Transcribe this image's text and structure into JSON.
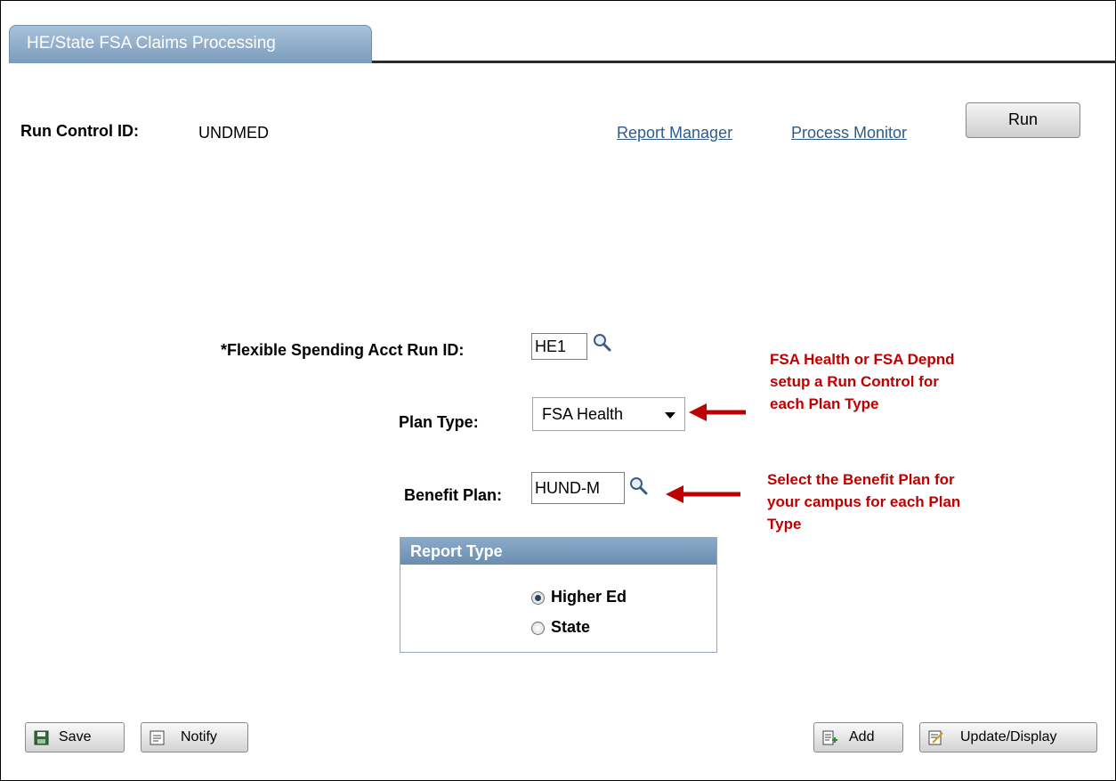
{
  "tab": {
    "title": "HE/State FSA Claims Processing"
  },
  "header": {
    "run_control_label": "Run Control ID:",
    "run_control_value": "UNDMED",
    "report_manager_link": "Report Manager",
    "process_monitor_link": "Process Monitor",
    "run_button": "Run"
  },
  "form": {
    "fsa_run_id": {
      "label": "*Flexible Spending Acct Run ID:",
      "value": "HE1"
    },
    "plan_type": {
      "label": "Plan Type:",
      "value": "FSA Health"
    },
    "benefit_plan": {
      "label": "Benefit Plan:",
      "value": "HUND-M"
    }
  },
  "annotations": {
    "plan_type_note": [
      "FSA Health or FSA Depnd",
      "setup a Run Control for",
      "each Plan Type"
    ],
    "benefit_plan_note": [
      "Select the Benefit Plan for",
      "your campus for each Plan",
      "Type"
    ]
  },
  "report_type": {
    "header": "Report Type",
    "options": [
      {
        "label": "Higher Ed",
        "selected": true
      },
      {
        "label": "State",
        "selected": false
      }
    ]
  },
  "footer": {
    "save_button": "Save",
    "notify_button": "Notify",
    "add_button": "Add",
    "update_display_button": "Update/Display"
  },
  "colors": {
    "tab": "#7b9cbc",
    "link": "#2e5c8a",
    "annotation": "#c00000",
    "group_header": "#6a8db0"
  }
}
